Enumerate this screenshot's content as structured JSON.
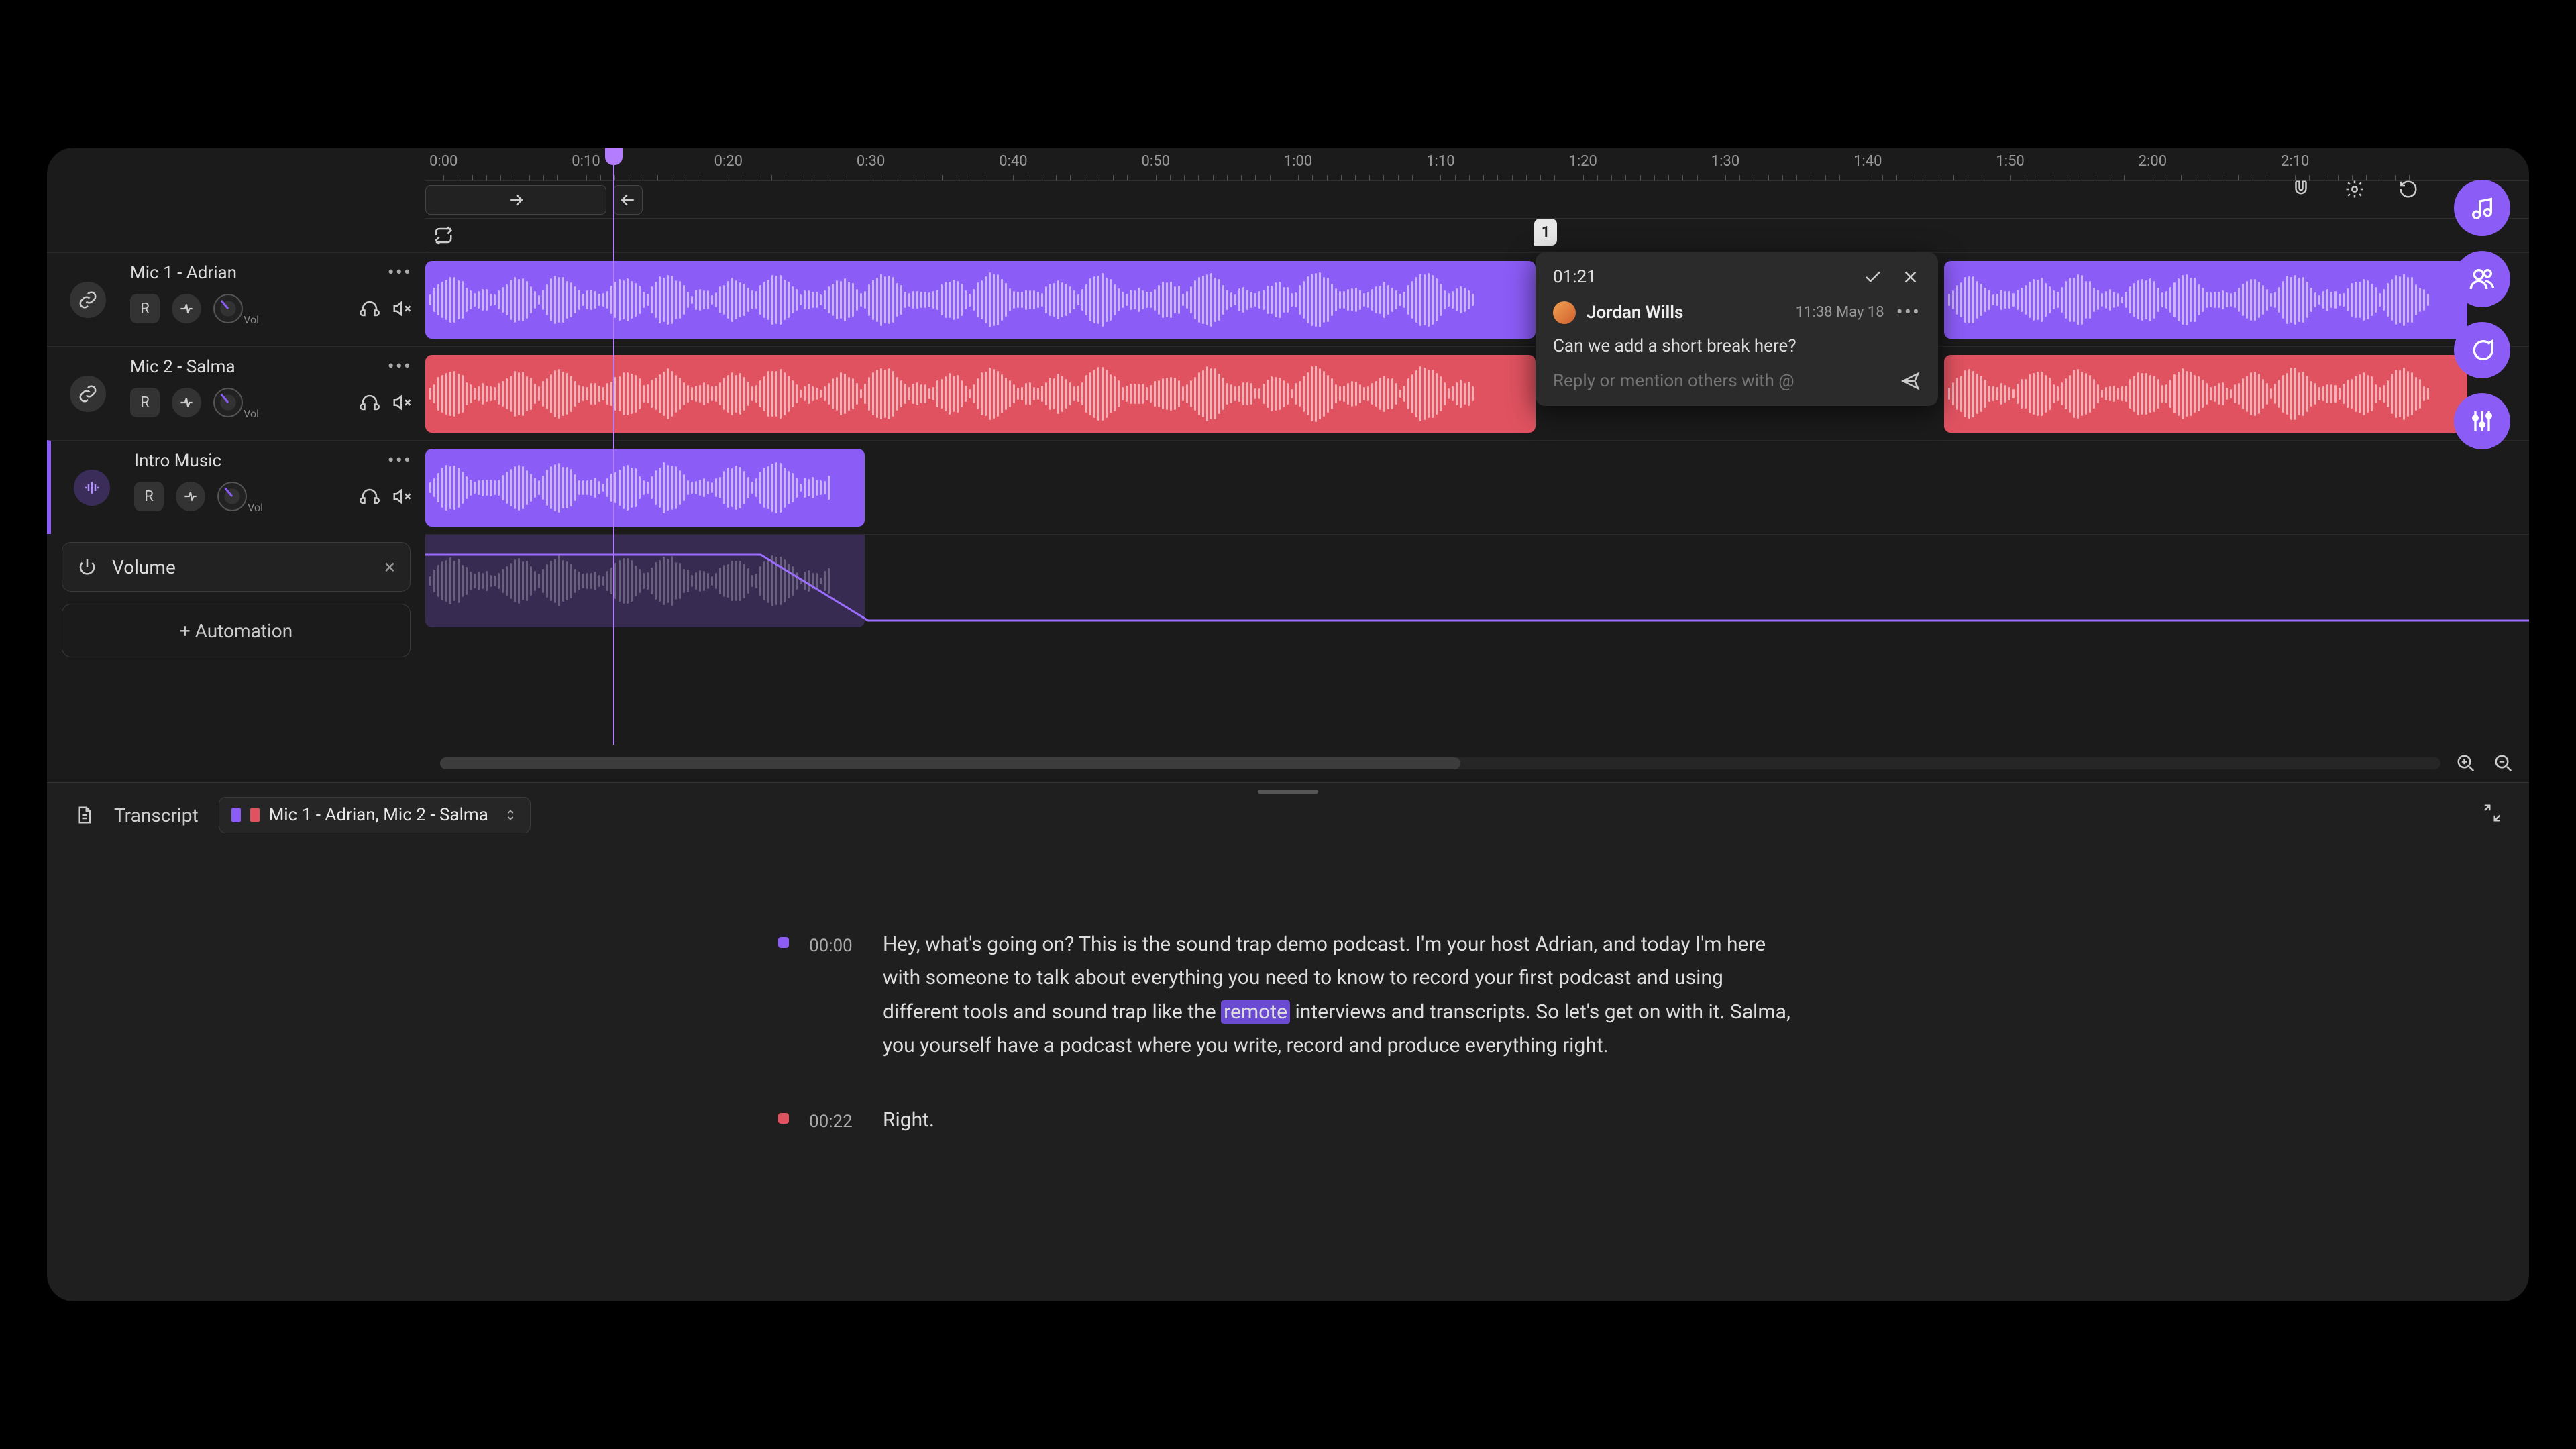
{
  "ruler": {
    "ticks": [
      "0:00",
      "0:10",
      "0:20",
      "0:30",
      "0:40",
      "0:50",
      "1:00",
      "1:10",
      "1:20",
      "1:30",
      "1:40",
      "1:50",
      "2:00",
      "2:10"
    ]
  },
  "playhead_time": "0:12",
  "tracks": [
    {
      "name": "Mic 1 - Adrian",
      "color": "#8b5cf6",
      "rec_label": "R",
      "vol_label": "Vol"
    },
    {
      "name": "Mic 2 - Salma",
      "color": "#e05260",
      "rec_label": "R",
      "vol_label": "Vol"
    },
    {
      "name": "Intro Music",
      "color": "#8b5cf6",
      "rec_label": "R",
      "vol_label": "Vol"
    }
  ],
  "automation": {
    "chip_label": "Volume",
    "add_label": "+ Automation"
  },
  "comment": {
    "marker_count": "1",
    "timestamp": "01:21",
    "author": "Jordan Wills",
    "posted": "11:38 May 18",
    "body": "Can we add a short break here?",
    "reply_placeholder": "Reply or mention others with @"
  },
  "transcript": {
    "title": "Transcript",
    "track_selector": "Mic 1 - Adrian, Mic 2 - Salma",
    "entries": [
      {
        "color": "#8b5cf6",
        "time": "00:00",
        "text_before": "Hey, what's going on? This is the sound trap demo podcast. I'm your host Adrian, and today I'm here with someone to talk about everything you need to know to record your first podcast and using different tools and sound trap like the ",
        "highlight": "remote",
        "text_after": " interviews and transcripts. So let's get on with it. Salma, you yourself have a podcast where you write, record and produce everything right."
      },
      {
        "color": "#e05260",
        "time": "00:22",
        "text_before": "Right.",
        "highlight": "",
        "text_after": ""
      }
    ]
  },
  "right_rail": [
    "music",
    "people",
    "chat",
    "mixer"
  ],
  "colors": {
    "purple": "#8b5cf6",
    "red": "#e05260"
  }
}
